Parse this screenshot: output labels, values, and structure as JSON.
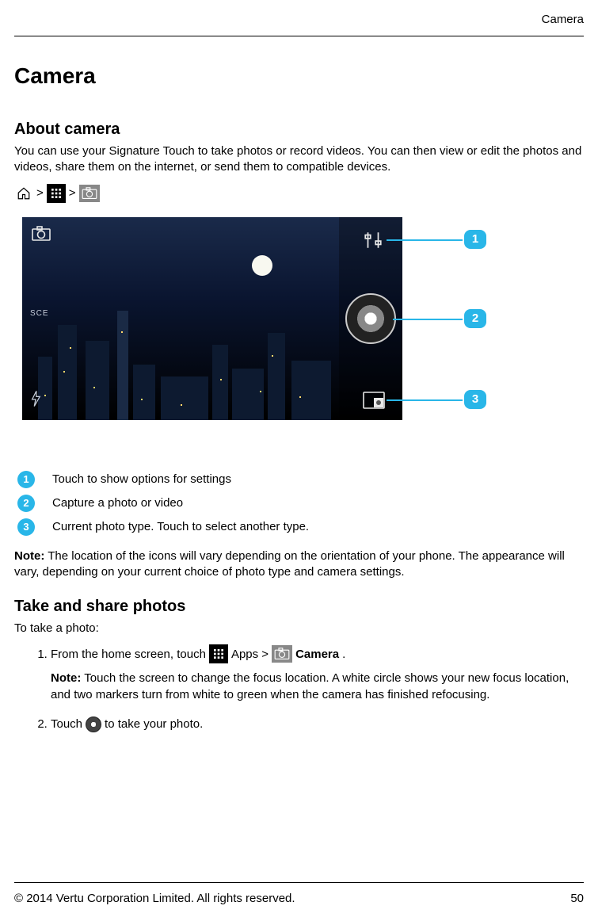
{
  "header_section": "Camera",
  "title": "Camera",
  "about": {
    "heading": "About camera",
    "intro": "You can use your Signature Touch to take photos or record videos. You can then view or edit the photos and videos, share them on the internet, or send them to compatible devices."
  },
  "nav": {
    "sep1": ">",
    "sep2": ">"
  },
  "figure": {
    "sce_label": "SCE",
    "badges": {
      "b1": "1",
      "b2": "2",
      "b3": "3"
    }
  },
  "legend": {
    "items": [
      {
        "num": "1",
        "text": "Touch to show options for settings"
      },
      {
        "num": "2",
        "text": "Capture a photo or video"
      },
      {
        "num": "3",
        "text": "Current photo type. Touch to select another type."
      }
    ]
  },
  "note_label": "Note:",
  "note_body": " The location of the icons will vary depending on the orientation of your phone. The appearance will vary, depending on your current choice of photo type and camera settings.",
  "take": {
    "heading": "Take and share photos",
    "intro": "To take a photo:",
    "step1_a": "From the home screen, touch",
    "step1_b": "Apps >",
    "step1_c": "Camera",
    "step1_d": ".",
    "step1_note": " Touch the screen to change the focus location. A white circle shows your new focus location, and two markers turn from white to green when the camera has finished refocusing.",
    "step2_a": "Touch",
    "step2_b": "to take your photo."
  },
  "footer": {
    "copyright": "© 2014 Vertu Corporation Limited. All rights reserved.",
    "page": "50"
  }
}
